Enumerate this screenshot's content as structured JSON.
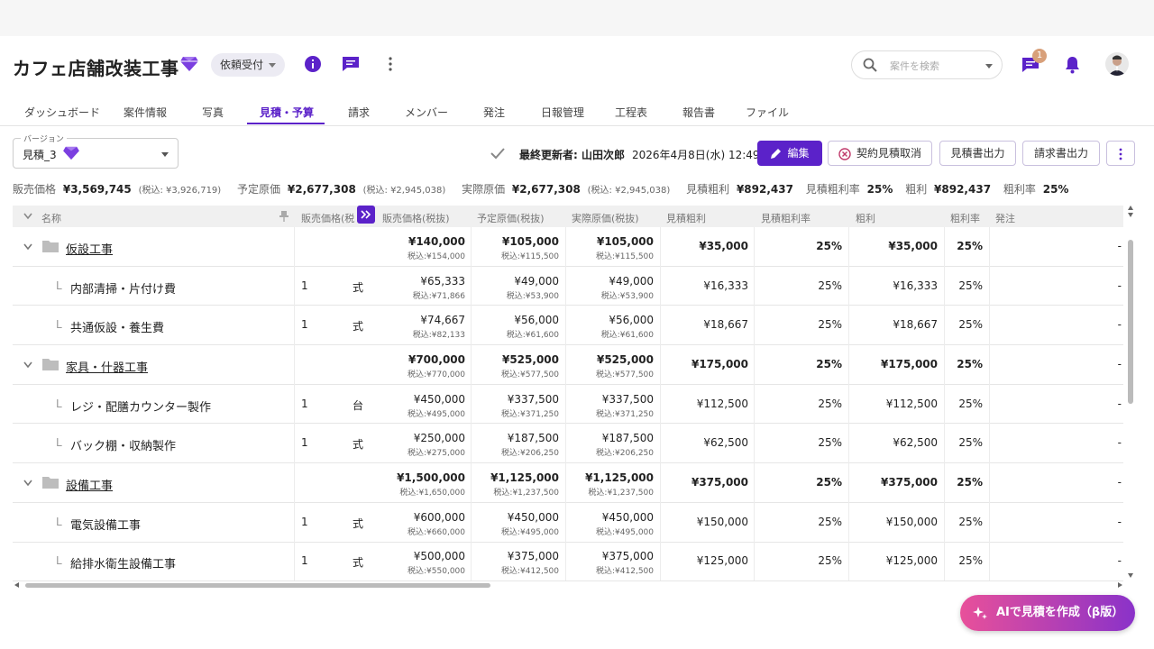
{
  "page": {
    "title": "カフェ店舗改装工事",
    "status_chip": "依頼受付",
    "search_placeholder": "案件を検索",
    "notification_count": "1"
  },
  "tabs": [
    "ダッシュボード",
    "案件情報",
    "写真",
    "見積・予算",
    "請求",
    "メンバー",
    "発注",
    "日報管理",
    "工程表",
    "報告書",
    "ファイル"
  ],
  "active_tab": "見積・予算",
  "version": {
    "label": "バージョン",
    "value": "見積_3"
  },
  "last_update": {
    "label": "最終更新者: 山田次郎",
    "datetime": "2026年4月8日(水) 12:49"
  },
  "actions": {
    "edit": "編集",
    "cancel_contract": "契約見積取消",
    "export_estimate": "見積書出力",
    "export_invoice": "請求書出力"
  },
  "summary": {
    "sales_label": "販売価格",
    "sales": "¥3,569,745",
    "sales_tax": "(税込: ¥3,926,719)",
    "planned_label": "予定原価",
    "planned": "¥2,677,308",
    "planned_tax": "(税込: ¥2,945,038)",
    "actual_label": "実際原価",
    "actual": "¥2,677,308",
    "actual_tax": "(税込: ¥2,945,038)",
    "est_profit_label": "見積粗利",
    "est_profit": "¥892,437",
    "est_rate_label": "見積粗利率",
    "est_rate": "25%",
    "profit_label": "粗利",
    "profit": "¥892,437",
    "rate_label": "粗利率",
    "rate": "25%"
  },
  "columns": [
    "名称",
    "販売価格(税",
    "販売価格(税抜)",
    "予定原価(税抜)",
    "実際原価(税抜)",
    "見積粗利",
    "見積粗利率",
    "粗利",
    "粗利率",
    "発注"
  ],
  "rows": [
    {
      "type": "group",
      "name": "仮設工事",
      "qty": "",
      "unit": "",
      "sales": "¥140,000",
      "sales_tax": "税込:¥154,000",
      "plan": "¥105,000",
      "plan_tax": "税込:¥115,500",
      "actual": "¥105,000",
      "actual_tax": "税込:¥115,500",
      "est_profit": "¥35,000",
      "est_rate": "25%",
      "profit": "¥35,000",
      "rate": "25%",
      "order": "-"
    },
    {
      "type": "item",
      "name": "内部清掃・片付け費",
      "qty": "1",
      "unit": "式",
      "sales": "¥65,333",
      "sales_tax": "税込:¥71,866",
      "plan": "¥49,000",
      "plan_tax": "税込:¥53,900",
      "actual": "¥49,000",
      "actual_tax": "税込:¥53,900",
      "est_profit": "¥16,333",
      "est_rate": "25%",
      "profit": "¥16,333",
      "rate": "25%",
      "order": "-"
    },
    {
      "type": "item",
      "name": "共通仮設・養生費",
      "qty": "1",
      "unit": "式",
      "sales": "¥74,667",
      "sales_tax": "税込:¥82,133",
      "plan": "¥56,000",
      "plan_tax": "税込:¥61,600",
      "actual": "¥56,000",
      "actual_tax": "税込:¥61,600",
      "est_profit": "¥18,667",
      "est_rate": "25%",
      "profit": "¥18,667",
      "rate": "25%",
      "order": "-"
    },
    {
      "type": "group",
      "name": "家具・什器工事",
      "qty": "",
      "unit": "",
      "sales": "¥700,000",
      "sales_tax": "税込:¥770,000",
      "plan": "¥525,000",
      "plan_tax": "税込:¥577,500",
      "actual": "¥525,000",
      "actual_tax": "税込:¥577,500",
      "est_profit": "¥175,000",
      "est_rate": "25%",
      "profit": "¥175,000",
      "rate": "25%",
      "order": "-"
    },
    {
      "type": "item",
      "name": "レジ・配膳カウンター製作",
      "qty": "1",
      "unit": "台",
      "sales": "¥450,000",
      "sales_tax": "税込:¥495,000",
      "plan": "¥337,500",
      "plan_tax": "税込:¥371,250",
      "actual": "¥337,500",
      "actual_tax": "税込:¥371,250",
      "est_profit": "¥112,500",
      "est_rate": "25%",
      "profit": "¥112,500",
      "rate": "25%",
      "order": "-"
    },
    {
      "type": "item",
      "name": "バック棚・収納製作",
      "qty": "1",
      "unit": "式",
      "sales": "¥250,000",
      "sales_tax": "税込:¥275,000",
      "plan": "¥187,500",
      "plan_tax": "税込:¥206,250",
      "actual": "¥187,500",
      "actual_tax": "税込:¥206,250",
      "est_profit": "¥62,500",
      "est_rate": "25%",
      "profit": "¥62,500",
      "rate": "25%",
      "order": "-"
    },
    {
      "type": "group",
      "name": "設備工事",
      "qty": "",
      "unit": "",
      "sales": "¥1,500,000",
      "sales_tax": "税込:¥1,650,000",
      "plan": "¥1,125,000",
      "plan_tax": "税込:¥1,237,500",
      "actual": "¥1,125,000",
      "actual_tax": "税込:¥1,237,500",
      "est_profit": "¥375,000",
      "est_rate": "25%",
      "profit": "¥375,000",
      "rate": "25%",
      "order": "-"
    },
    {
      "type": "item",
      "name": "電気設備工事",
      "qty": "1",
      "unit": "式",
      "sales": "¥600,000",
      "sales_tax": "税込:¥660,000",
      "plan": "¥450,000",
      "plan_tax": "税込:¥495,000",
      "actual": "¥450,000",
      "actual_tax": "税込:¥495,000",
      "est_profit": "¥150,000",
      "est_rate": "25%",
      "profit": "¥150,000",
      "rate": "25%",
      "order": "-"
    },
    {
      "type": "item",
      "name": "給排水衛生設備工事",
      "qty": "1",
      "unit": "式",
      "sales": "¥500,000",
      "sales_tax": "税込:¥550,000",
      "plan": "¥375,000",
      "plan_tax": "税込:¥412,500",
      "actual": "¥375,000",
      "actual_tax": "税込:¥412,500",
      "est_profit": "¥125,000",
      "est_rate": "25%",
      "profit": "¥125,000",
      "rate": "25%",
      "order": "-"
    }
  ],
  "ai_button": "AIで見積を作成（β版）",
  "colors": {
    "accent": "#5b22c9",
    "ai_gradient_start": "#e8509a",
    "ai_gradient_end": "#8a32c9"
  }
}
